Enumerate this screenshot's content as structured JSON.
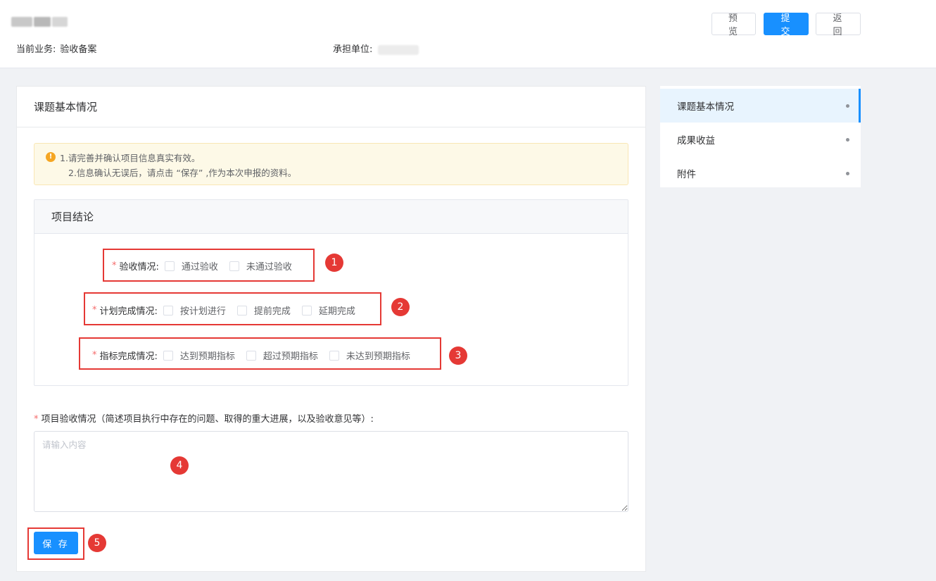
{
  "header": {
    "business_label": "当前业务:",
    "business_value": "验收备案",
    "unit_label": "承担单位:",
    "buttons": {
      "preview": "预 览",
      "submit": "提 交",
      "back": "返 回"
    }
  },
  "card": {
    "title": "课题基本情况",
    "notice": {
      "line1": "1.请完善并确认项目信息真实有效。",
      "line2": "2.信息确认无误后，请点击 “保存” ,作为本次申报的资料。"
    },
    "section": {
      "title": "项目结论",
      "fields": [
        {
          "label": "验收情况:",
          "options": [
            "通过验收",
            "未通过验收"
          ]
        },
        {
          "label": "计划完成情况:",
          "options": [
            "按计划进行",
            "提前完成",
            "延期完成"
          ]
        },
        {
          "label": "指标完成情况:",
          "options": [
            "达到预期指标",
            "超过预期指标",
            "未达到预期指标"
          ]
        }
      ]
    },
    "textarea": {
      "label": "项目验收情况（简述项目执行中存在的问题、取得的重大进展，以及验收意见等）:",
      "placeholder": "请输入内容",
      "value": ""
    },
    "save_label": "保 存",
    "required_mark": "*"
  },
  "annotations": [
    "1",
    "2",
    "3",
    "4",
    "5"
  ],
  "sidebar": {
    "items": [
      {
        "label": "课题基本情况",
        "active": true
      },
      {
        "label": "成果收益",
        "active": false
      },
      {
        "label": "附件",
        "active": false
      }
    ]
  },
  "colors": {
    "primary": "#1890ff",
    "annotation": "#e53935",
    "required": "#f56c6c"
  }
}
